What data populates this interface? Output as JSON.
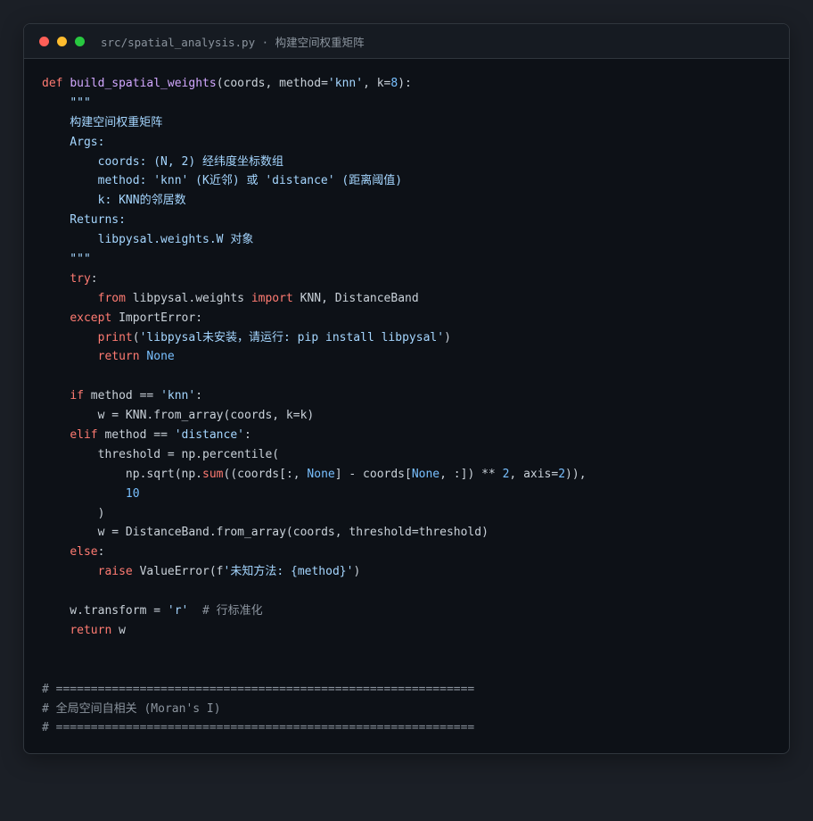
{
  "window": {
    "title": "src/spatial_analysis.py · 构建空间权重矩阵",
    "controls": [
      "close",
      "minimize",
      "maximize"
    ]
  },
  "code_lines": [
    [
      {
        "t": "def",
        "c": "kw"
      },
      {
        "t": " "
      },
      {
        "t": "build_spatial_weights",
        "c": "fn"
      },
      {
        "t": "(coords, method="
      },
      {
        "t": "'knn'",
        "c": "str"
      },
      {
        "t": ", k="
      },
      {
        "t": "8",
        "c": "num"
      },
      {
        "t": "):"
      }
    ],
    [
      {
        "t": "    "
      },
      {
        "t": "\"\"\"",
        "c": "str"
      }
    ],
    [
      {
        "t": "    构建空间权重矩阵",
        "c": "str"
      }
    ],
    [
      {
        "t": "    Args:",
        "c": "str"
      }
    ],
    [
      {
        "t": "        coords: (N, 2) 经纬度坐标数组",
        "c": "str"
      }
    ],
    [
      {
        "t": "        method: 'knn' (K近邻) 或 'distance' (距离阈值)",
        "c": "str"
      }
    ],
    [
      {
        "t": "        k: KNN的邻居数",
        "c": "str"
      }
    ],
    [
      {
        "t": "    Returns:",
        "c": "str"
      }
    ],
    [
      {
        "t": "        libpysal.weights.W 对象",
        "c": "str"
      }
    ],
    [
      {
        "t": "    \"\"\"",
        "c": "str"
      }
    ],
    [
      {
        "t": "    "
      },
      {
        "t": "try",
        "c": "kw"
      },
      {
        "t": ":"
      }
    ],
    [
      {
        "t": "        "
      },
      {
        "t": "from",
        "c": "kw"
      },
      {
        "t": " libpysal.weights "
      },
      {
        "t": "import",
        "c": "kw"
      },
      {
        "t": " KNN, DistanceBand"
      }
    ],
    [
      {
        "t": "    "
      },
      {
        "t": "except",
        "c": "kw"
      },
      {
        "t": " ImportError:"
      }
    ],
    [
      {
        "t": "        "
      },
      {
        "t": "print",
        "c": "kw"
      },
      {
        "t": "("
      },
      {
        "t": "'libpysal未安装，请运行: pip install libpysal'",
        "c": "str"
      },
      {
        "t": ")"
      }
    ],
    [
      {
        "t": "        "
      },
      {
        "t": "return",
        "c": "kw"
      },
      {
        "t": " "
      },
      {
        "t": "None",
        "c": "const"
      }
    ],
    [
      {
        "t": ""
      }
    ],
    [
      {
        "t": "    "
      },
      {
        "t": "if",
        "c": "kw"
      },
      {
        "t": " method == "
      },
      {
        "t": "'knn'",
        "c": "str"
      },
      {
        "t": ":"
      }
    ],
    [
      {
        "t": "        w = KNN.from_array(coords, k=k)"
      }
    ],
    [
      {
        "t": "    "
      },
      {
        "t": "elif",
        "c": "kw"
      },
      {
        "t": " method == "
      },
      {
        "t": "'distance'",
        "c": "str"
      },
      {
        "t": ":"
      }
    ],
    [
      {
        "t": "        threshold = np.percentile("
      }
    ],
    [
      {
        "t": "            np.sqrt(np."
      },
      {
        "t": "sum",
        "c": "kw"
      },
      {
        "t": "((coords[:, "
      },
      {
        "t": "None",
        "c": "const"
      },
      {
        "t": "] - coords["
      },
      {
        "t": "None",
        "c": "const"
      },
      {
        "t": ", :]) ** "
      },
      {
        "t": "2",
        "c": "num"
      },
      {
        "t": ", axis="
      },
      {
        "t": "2",
        "c": "num"
      },
      {
        "t": ")),"
      }
    ],
    [
      {
        "t": "            "
      },
      {
        "t": "10",
        "c": "num"
      }
    ],
    [
      {
        "t": "        )"
      }
    ],
    [
      {
        "t": "        w = DistanceBand.from_array(coords, threshold=threshold)"
      }
    ],
    [
      {
        "t": "    "
      },
      {
        "t": "else",
        "c": "kw"
      },
      {
        "t": ":"
      }
    ],
    [
      {
        "t": "        "
      },
      {
        "t": "raise",
        "c": "kw"
      },
      {
        "t": " ValueError(f"
      },
      {
        "t": "'未知方法: {method}'",
        "c": "str"
      },
      {
        "t": ")"
      }
    ],
    [
      {
        "t": ""
      }
    ],
    [
      {
        "t": "    w.transform = "
      },
      {
        "t": "'r'",
        "c": "str"
      },
      {
        "t": "  "
      },
      {
        "t": "# 行标准化",
        "c": "cm"
      }
    ],
    [
      {
        "t": "    "
      },
      {
        "t": "return",
        "c": "kw"
      },
      {
        "t": " w"
      }
    ],
    [
      {
        "t": ""
      }
    ],
    [
      {
        "t": ""
      }
    ],
    [
      {
        "t": "# ============================================================",
        "c": "cm"
      }
    ],
    [
      {
        "t": "# 全局空间自相关 (Moran's I)",
        "c": "cm"
      }
    ],
    [
      {
        "t": "# ============================================================",
        "c": "cm"
      }
    ]
  ]
}
